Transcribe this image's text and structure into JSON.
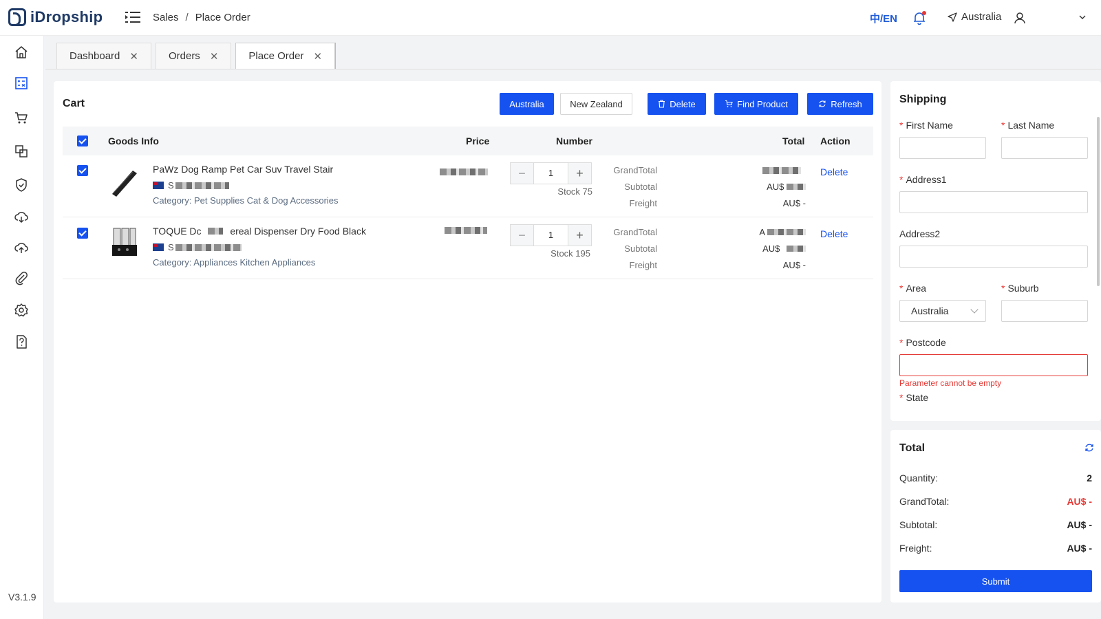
{
  "header": {
    "logo_text": "iDropship",
    "breadcrumb": [
      "Sales",
      "Place Order"
    ],
    "breadcrumb_sep": "/",
    "language": "中/EN",
    "location": "Australia"
  },
  "sidebar": {
    "icons": [
      "home-icon",
      "order-list-icon",
      "cart-icon",
      "products-icon",
      "shield-icon",
      "cloud-download-icon",
      "cloud-upload-icon",
      "attachment-icon",
      "gear-icon",
      "help-document-icon"
    ],
    "version": "V3.1.9"
  },
  "tabs": [
    {
      "label": "Dashboard",
      "active": false
    },
    {
      "label": "Orders",
      "active": false
    },
    {
      "label": "Place Order",
      "active": true
    }
  ],
  "cart": {
    "title": "Cart",
    "buttons": {
      "australia": "Australia",
      "new_zealand": "New Zealand",
      "delete": "Delete",
      "find_product": "Find Product",
      "refresh": "Refresh"
    },
    "columns": {
      "goods_info": "Goods Info",
      "price": "Price",
      "number": "Number",
      "total": "Total",
      "action": "Action"
    },
    "items": [
      {
        "name": "PaWz Dog Ramp Pet Car Suv Travel Stair",
        "ship_prefix": "S",
        "category": "Category: Pet Supplies Cat & Dog Accessories",
        "quantity": "1",
        "stock": "Stock 75",
        "grandtotal_label": "GrandTotal",
        "subtotal_label": "Subtotal",
        "freight_label": "Freight",
        "subtotal_value_prefix": "AU$",
        "freight_value": "AU$ -",
        "action": "Delete"
      },
      {
        "name_start": "TOQUE Dc",
        "name_end": "ereal Dispenser Dry Food Black",
        "ship_prefix": "S",
        "category": "Category: Appliances Kitchen Appliances",
        "quantity": "1",
        "stock": "Stock 195",
        "grandtotal_label": "GrandTotal",
        "subtotal_label": "Subtotal",
        "freight_label": "Freight",
        "grandtotal_value_prefix": "A",
        "subtotal_value_prefix": "AU$",
        "freight_value": "AU$ -",
        "action": "Delete"
      }
    ]
  },
  "shipping": {
    "title": "Shipping",
    "first_name": "First Name",
    "last_name": "Last Name",
    "address1": "Address1",
    "address2": "Address2",
    "area": "Area",
    "area_value": "Australia",
    "suburb": "Suburb",
    "postcode": "Postcode",
    "postcode_error": "Parameter cannot be empty",
    "state": "State",
    "required_mark": "*"
  },
  "total": {
    "title": "Total",
    "quantity_label": "Quantity:",
    "quantity_value": "2",
    "grandtotal_label": "GrandTotal:",
    "grandtotal_value": "AU$ -",
    "subtotal_label": "Subtotal:",
    "subtotal_value": "AU$ -",
    "freight_label": "Freight:",
    "freight_value": "AU$ -",
    "submit": "Submit"
  },
  "colors": {
    "primary": "#1652f0",
    "error": "#e53935",
    "brand": "#1f3a66"
  }
}
